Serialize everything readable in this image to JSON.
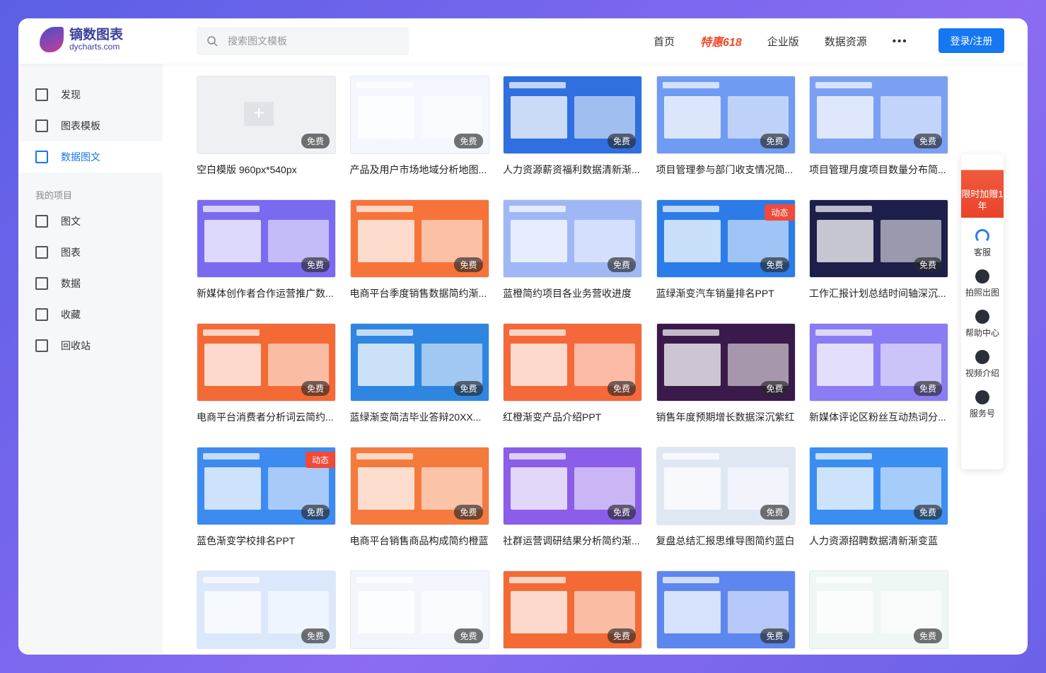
{
  "header": {
    "logo_cn": "镝数图表",
    "logo_en": "dycharts.com",
    "search_placeholder": "搜索图文模板",
    "nav": [
      "首页",
      "特惠618",
      "企业版",
      "数据资源",
      "•••"
    ],
    "login": "登录/注册"
  },
  "sidebar": {
    "items": [
      {
        "label": "发现",
        "icon": "home-icon"
      },
      {
        "label": "图表模板",
        "icon": "chart-icon"
      },
      {
        "label": "数据图文",
        "icon": "article-icon",
        "active": true
      }
    ],
    "section": "我的项目",
    "project_items": [
      {
        "label": "图文",
        "icon": "folder-icon"
      },
      {
        "label": "图表",
        "icon": "bar-chart-icon"
      },
      {
        "label": "数据",
        "icon": "table-icon"
      },
      {
        "label": "收藏",
        "icon": "star-icon"
      },
      {
        "label": "回收站",
        "icon": "trash-icon"
      }
    ]
  },
  "colors": {
    "accent": "#1677f2",
    "promo": "#f04a2a"
  },
  "cards": [
    {
      "title": "空白模版 960px*540px",
      "badge": "免费",
      "bg": "#eef0f3",
      "blank": true
    },
    {
      "title": "产品及用户市场地域分析地图...",
      "badge": "免费",
      "bg": "#f4f7ff"
    },
    {
      "title": "人力资源薪资福利数据清新渐...",
      "badge": "免费",
      "bg": "#2f6fe0"
    },
    {
      "title": "项目管理参与部门收支情况简...",
      "badge": "免费",
      "bg": "#6f9bf2"
    },
    {
      "title": "项目管理月度项目数量分布简...",
      "badge": "免费",
      "bg": "#7ba0f3"
    },
    {
      "title": "新媒体创作者合作运营推广数...",
      "badge": "免费",
      "bg": "#7a6af0"
    },
    {
      "title": "电商平台季度销售数据简约渐...",
      "badge": "免费",
      "bg": "#f7733a"
    },
    {
      "title": "蓝橙简约项目各业务营收进度",
      "badge": "免费",
      "bg": "#9fb8f5"
    },
    {
      "title": "蓝绿渐变汽车销量排名PPT",
      "badge": "免费",
      "bg": "#2b7ce8",
      "dynamic": "动态"
    },
    {
      "title": "工作汇报计划总结时间轴深沉...",
      "badge": "免费",
      "bg": "#1d1f4a"
    },
    {
      "title": "电商平台消费者分析词云简约...",
      "badge": "免费",
      "bg": "#f46a34"
    },
    {
      "title": "蓝绿渐变简洁毕业答辩20XX...",
      "badge": "免费",
      "bg": "#2f86e0"
    },
    {
      "title": "红橙渐变产品介绍PPT",
      "badge": "免费",
      "bg": "#f5683a"
    },
    {
      "title": "销售年度预期增长数据深沉紫红",
      "badge": "免费",
      "bg": "#3a1a4a"
    },
    {
      "title": "新媒体评论区粉丝互动热词分...",
      "badge": "免费",
      "bg": "#8a7cf2"
    },
    {
      "title": "蓝色渐变学校排名PPT",
      "badge": "免费",
      "bg": "#3d8af0",
      "dynamic": "动态"
    },
    {
      "title": "电商平台销售商品构成简约橙蓝",
      "badge": "免费",
      "bg": "#f57a3e"
    },
    {
      "title": "社群运营调研结果分析简约渐...",
      "badge": "免费",
      "bg": "#8a5ee8"
    },
    {
      "title": "复盘总结汇报思维导图简约蓝白",
      "badge": "免费",
      "bg": "#dfe7f3"
    },
    {
      "title": "人力资源招聘数据清新渐变蓝",
      "badge": "免费",
      "bg": "#3a8ef2"
    },
    {
      "title": "",
      "badge": "免费",
      "bg": "#dbe8fb"
    },
    {
      "title": "",
      "badge": "免费",
      "bg": "#f2f5fc"
    },
    {
      "title": "",
      "badge": "免费",
      "bg": "#f46a34"
    },
    {
      "title": "",
      "badge": "免费",
      "bg": "#5d86ee"
    },
    {
      "title": "",
      "badge": "免费",
      "bg": "#eef7f4"
    }
  ],
  "float_panel": {
    "promo": "限时加赠1年",
    "items": [
      {
        "label": "客服",
        "icon": "headset-icon"
      },
      {
        "label": "拍照出图",
        "icon": "link-icon"
      },
      {
        "label": "帮助中心",
        "icon": "help-icon"
      },
      {
        "label": "视频介绍",
        "icon": "video-icon"
      },
      {
        "label": "服务号",
        "icon": "document-icon"
      }
    ]
  }
}
